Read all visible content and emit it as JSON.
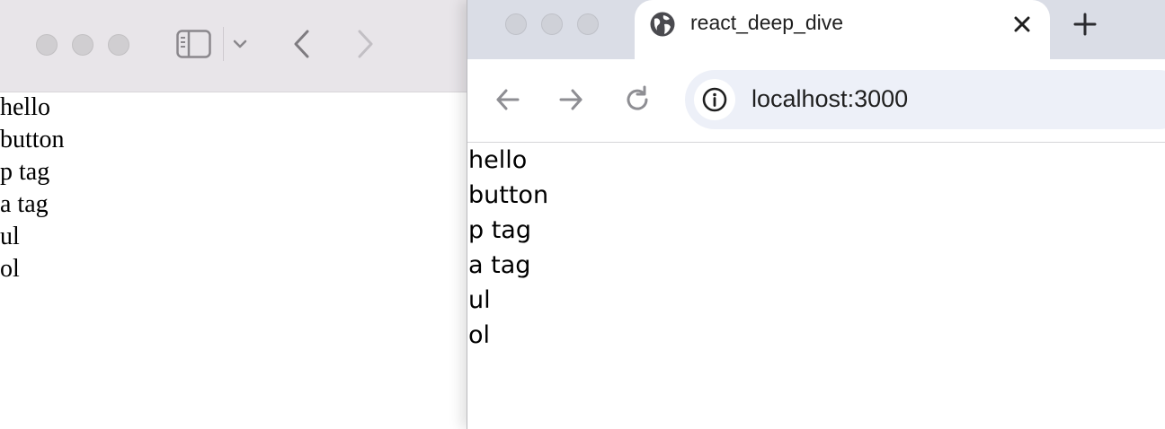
{
  "left_window": {
    "toolbar": {
      "sidebar_icon": "sidebar-icon",
      "chevron_icon": "chevron-down-icon",
      "back_icon": "back-arrow-icon",
      "forward_icon": "forward-arrow-icon"
    },
    "content_lines": [
      "hello",
      "button",
      "p tag",
      "a tag",
      "ul",
      "ol"
    ]
  },
  "right_window": {
    "tab": {
      "title": "react_deep_dive",
      "favicon": "globe-icon",
      "close_icon": "close-icon"
    },
    "new_tab_icon": "plus-icon",
    "address_bar": {
      "url": "localhost:3000",
      "info_icon": "info-icon"
    },
    "content_lines": [
      "hello",
      "button",
      "p tag",
      "a tag",
      "ul",
      "ol"
    ]
  },
  "colors": {
    "left_toolbar_bg": "#e8e5e9",
    "tabstrip_bg": "#dadde6",
    "omnibox_bg": "#edf0f8"
  }
}
